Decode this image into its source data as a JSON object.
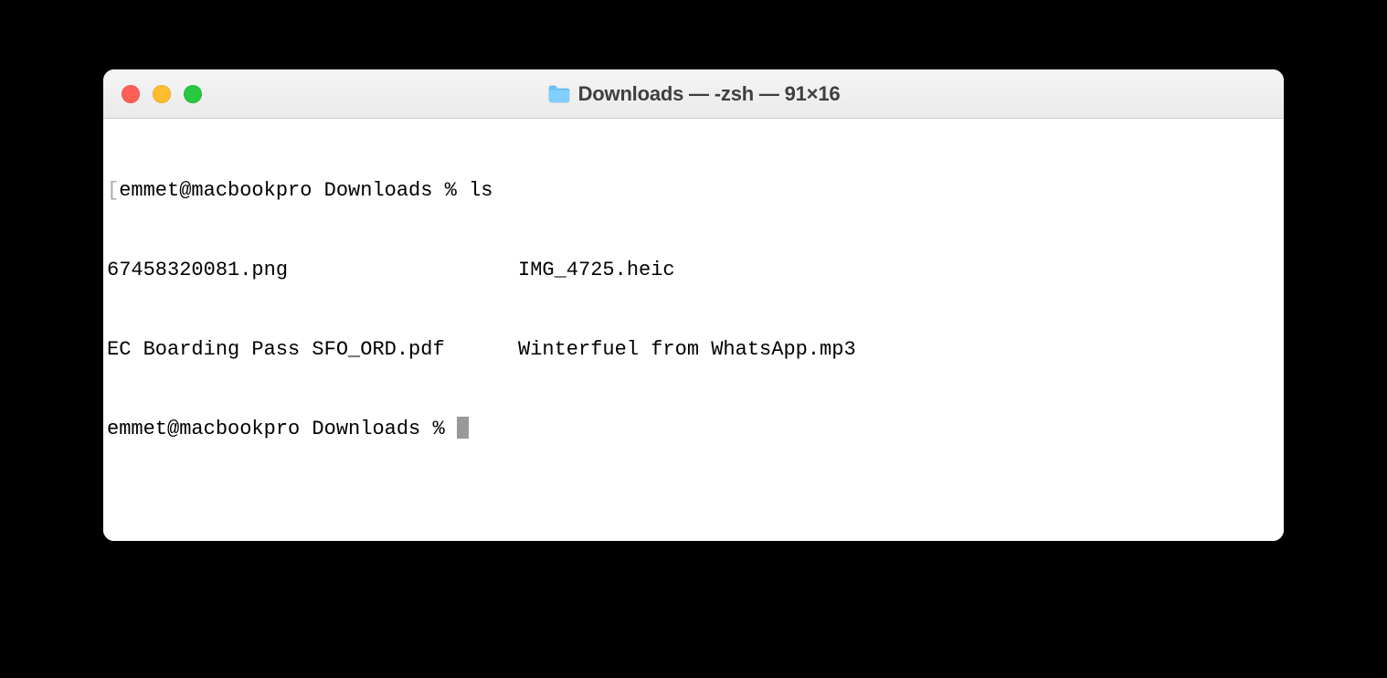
{
  "window": {
    "title": "Downloads — -zsh — 91×16",
    "folder_icon": "folder-icon"
  },
  "terminal": {
    "prompt1_bracket": "[",
    "prompt1": "emmet@macbookpro Downloads % ls",
    "ls_output": {
      "col1": [
        "67458320081.png",
        "EC Boarding Pass SFO_ORD.pdf"
      ],
      "col2": [
        "IMG_4725.heic",
        "Winterfuel from WhatsApp.mp3"
      ]
    },
    "prompt2": "emmet@macbookpro Downloads % "
  }
}
